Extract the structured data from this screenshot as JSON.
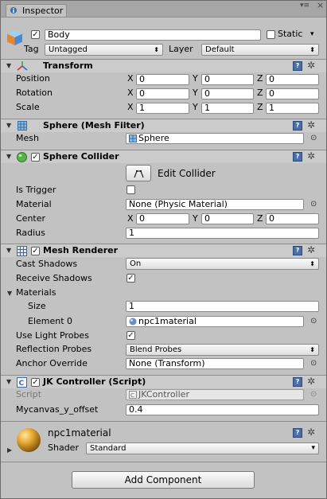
{
  "window": {
    "tab_label": "Inspector",
    "menu_glyph": "▾≡",
    "close_glyph": "×"
  },
  "object": {
    "name": "Body",
    "active": true,
    "static_label": "Static",
    "static_checked": false,
    "tag_label": "Tag",
    "tag_value": "Untagged",
    "layer_label": "Layer",
    "layer_value": "Default"
  },
  "transform": {
    "title": "Transform",
    "rows": [
      {
        "label": "Position",
        "x": "0",
        "y": "0",
        "z": "0"
      },
      {
        "label": "Rotation",
        "x": "0",
        "y": "0",
        "z": "0"
      },
      {
        "label": "Scale",
        "x": "1",
        "y": "1",
        "z": "1"
      }
    ],
    "axis_x": "X",
    "axis_y": "Y",
    "axis_z": "Z"
  },
  "mesh_filter": {
    "title": "Sphere (Mesh Filter)",
    "mesh_label": "Mesh",
    "mesh_value": "Sphere"
  },
  "sphere_collider": {
    "title": "Sphere Collider",
    "enabled": true,
    "edit_label": "Edit Collider",
    "is_trigger_label": "Is Trigger",
    "is_trigger": false,
    "material_label": "Material",
    "material_value": "None (Physic Material)",
    "center_label": "Center",
    "center_x": "0",
    "center_y": "0",
    "center_z": "0",
    "radius_label": "Radius",
    "radius_value": "1"
  },
  "mesh_renderer": {
    "title": "Mesh Renderer",
    "enabled": true,
    "cast_shadows_label": "Cast Shadows",
    "cast_shadows_value": "On",
    "receive_shadows_label": "Receive Shadows",
    "receive_shadows": true,
    "materials_label": "Materials",
    "size_label": "Size",
    "size_value": "1",
    "element0_label": "Element 0",
    "element0_value": "npc1material",
    "light_probes_label": "Use Light Probes",
    "light_probes": true,
    "reflection_probes_label": "Reflection Probes",
    "reflection_probes_value": "Blend Probes",
    "anchor_override_label": "Anchor Override",
    "anchor_override_value": "None (Transform)"
  },
  "jk_controller": {
    "title": "JK Controller (Script)",
    "enabled": true,
    "script_label": "Script",
    "script_value": "JKController",
    "offset_label": "Mycanvas_y_offset",
    "offset_value": "0.4"
  },
  "material": {
    "name": "npc1material",
    "shader_label": "Shader",
    "shader_value": "Standard"
  },
  "add_component_label": "Add Component",
  "icons": {
    "check": "✓",
    "arrow_down": "▼",
    "arrow_right": "▶",
    "dropdown": "▾",
    "updown": "⬍",
    "gear": "✲",
    "picker": "⊙",
    "book": "?"
  }
}
